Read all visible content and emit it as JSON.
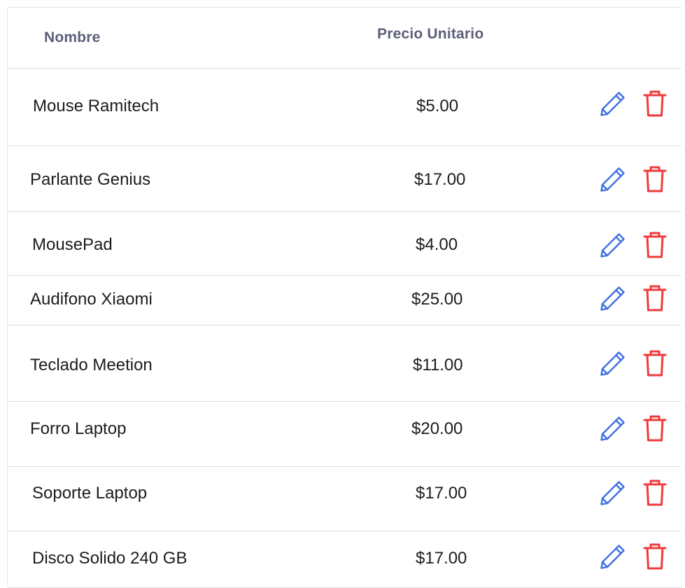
{
  "table": {
    "columns": {
      "name": "Nombre",
      "price": "Precio Unitario"
    },
    "rows": [
      {
        "name": "Mouse Ramitech",
        "price": "$5.00"
      },
      {
        "name": "Parlante Genius",
        "price": "$17.00"
      },
      {
        "name": "MousePad",
        "price": "$4.00"
      },
      {
        "name": "Audifono Xiaomi",
        "price": "$25.00"
      },
      {
        "name": "Teclado Meetion",
        "price": "$11.00"
      },
      {
        "name": "Forro Laptop",
        "price": "$20.00"
      },
      {
        "name": "Soporte Laptop",
        "price": "$17.00"
      },
      {
        "name": "Disco Solido 240 GB",
        "price": "$17.00"
      }
    ]
  },
  "icons": {
    "edit": "pencil-icon",
    "delete": "trash-icon"
  },
  "colors": {
    "edit": "#3f6fe0",
    "delete": "#ef3b3b",
    "header_text": "#5d5f78",
    "border": "#dcdcdf"
  }
}
